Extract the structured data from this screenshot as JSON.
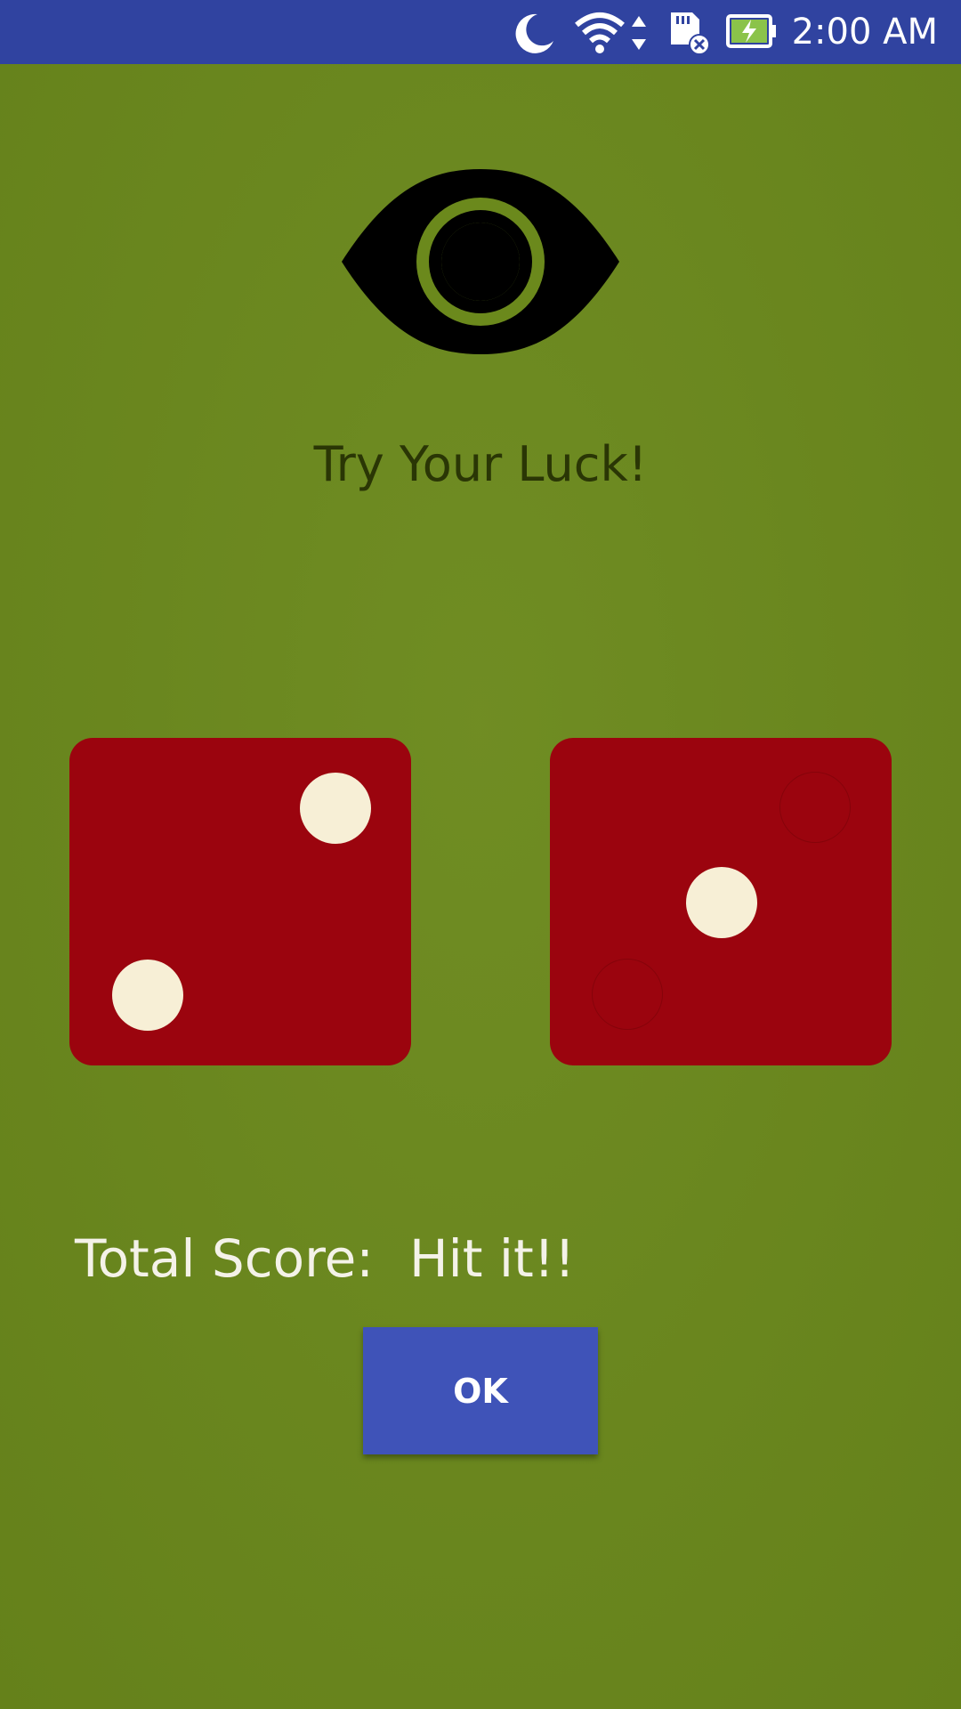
{
  "status_bar": {
    "time": "2:00 AM",
    "icons": [
      "do-not-disturb-moon-icon",
      "wifi-icon",
      "data-arrows-icon",
      "sd-card-error-icon",
      "battery-charging-icon"
    ],
    "background_color": "#3043a0"
  },
  "header": {
    "icon": "eye-icon",
    "title": "Try Your Luck!"
  },
  "dice": [
    {
      "face_value": 2,
      "color": "#9b040e",
      "pip_color": "#f7efd6"
    },
    {
      "face_value": 1,
      "color": "#9b040e",
      "pip_color": "#f7efd6"
    }
  ],
  "score": {
    "label": "Total Score:",
    "value": "Hit it!!"
  },
  "ok_button": {
    "label": "OK",
    "color": "#3f53b8"
  },
  "theme": {
    "felt_color": "#6b891c"
  }
}
